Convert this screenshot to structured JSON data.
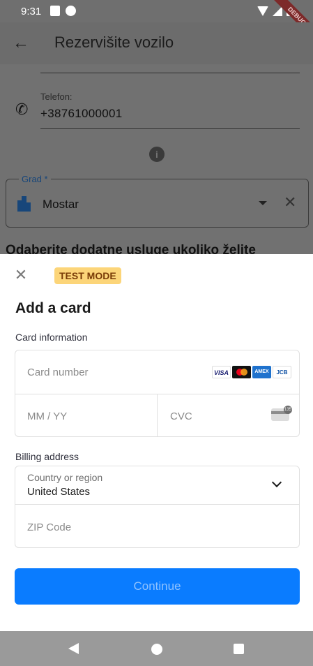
{
  "status_bar": {
    "time": "9:31",
    "debug_banner": "DEBUG"
  },
  "app_bar": {
    "back_icon": "arrow-left-icon",
    "title": "Rezervišite vozilo"
  },
  "form": {
    "phone_label": "Telefon:",
    "phone_value": "+38761000001",
    "info_icon": "info-icon",
    "city_label": "Grad *",
    "city_value": "Mostar",
    "section_heading": "Odaberite dodatne usluge ukoliko želite"
  },
  "payment_sheet": {
    "test_mode_badge": "TEST MODE",
    "title": "Add a card",
    "card_information_label": "Card information",
    "card_number_placeholder": "Card number",
    "card_brands": [
      "VISA",
      "Mastercard",
      "AMEX",
      "JCB"
    ],
    "expiry_placeholder": "MM / YY",
    "cvc_placeholder": "CVC",
    "cvc_icon_text": "135",
    "billing_address_label": "Billing address",
    "country_label": "Country or region",
    "country_value": "United States",
    "zip_placeholder": "ZIP Code",
    "continue_label": "Continue"
  },
  "colors": {
    "accent": "#0a7cff",
    "badge_bg": "#fcd579",
    "badge_text": "#7a3c07",
    "city_accent": "#17467a"
  }
}
